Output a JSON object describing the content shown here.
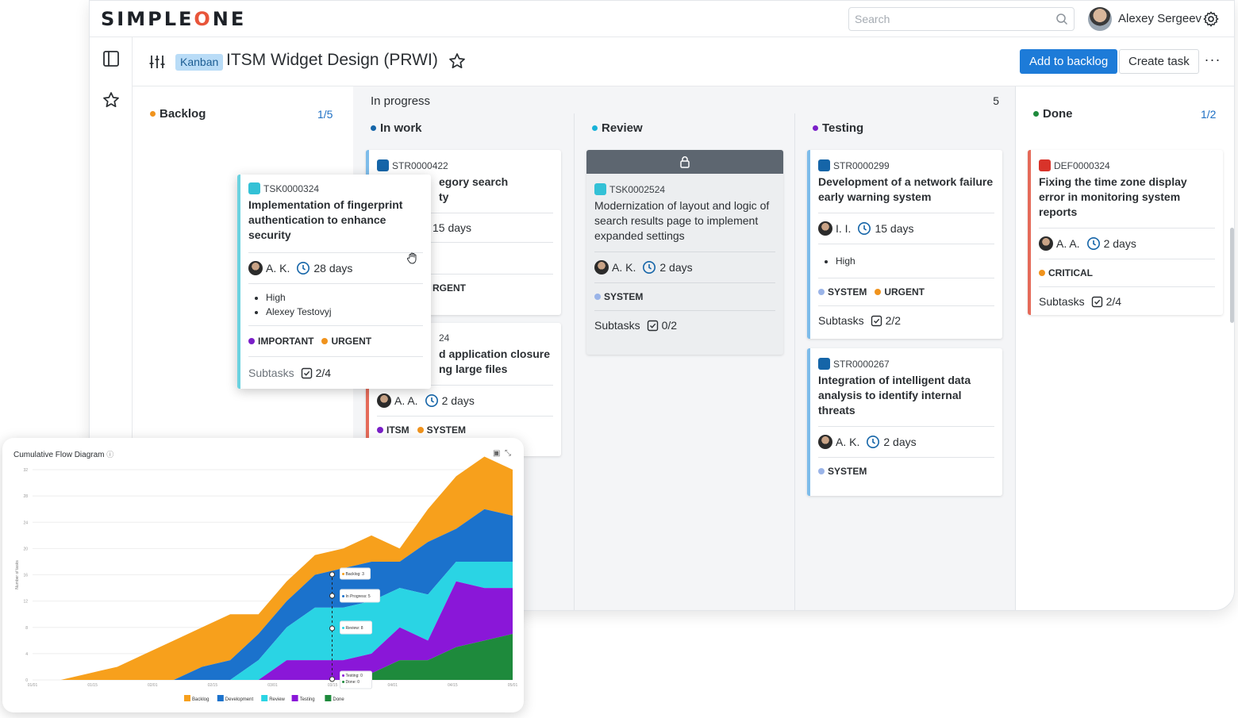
{
  "app": {
    "logo_left": "SIMPLE",
    "logo_o": "O",
    "logo_right": "NE",
    "search_placeholder": "Search",
    "user_name": "Alexey Sergeev"
  },
  "board": {
    "view_tag": "Kanban",
    "title": "ITSM Widget Design (PRWI)",
    "add_backlog": "Add to backlog",
    "create_task": "Create task",
    "more": "···"
  },
  "columns": {
    "backlog": {
      "label": "Backlog",
      "count": "1/5",
      "color": "#f0931d"
    },
    "in_progress": {
      "label": "In progress",
      "count": "5"
    },
    "in_work": {
      "label": "In work",
      "color": "#1565a8"
    },
    "review": {
      "label": "Review",
      "color": "#18b2d8"
    },
    "testing": {
      "label": "Testing",
      "color": "#7a1fc8"
    },
    "done": {
      "label": "Done",
      "count": "1/2",
      "color": "#1e8a3c"
    }
  },
  "cards": {
    "inwork1": {
      "code": "STR0000422",
      "title_visible": "egory search\nty",
      "days": "15 days",
      "tag": "RGENT"
    },
    "inwork2": {
      "code": "24",
      "title_visible": "d application closure\nng large files",
      "assignee": "A. A.",
      "days": "2 days",
      "tags": [
        "ITSM",
        "SYSTEM"
      ]
    },
    "review1": {
      "code": "TSK0002524",
      "title": "Modernization of layout and logic of search results page to implement expanded settings",
      "assignee": "A. K.",
      "days": "2 days",
      "tag": "SYSTEM",
      "subtasks_label": "Subtasks",
      "subtasks": "0/2"
    },
    "testing1": {
      "code": "STR0000299",
      "title": "Development of a network failure early warning system",
      "assignee": "I. I.",
      "days": "15 days",
      "priority": "High",
      "tags": [
        "SYSTEM",
        "URGENT"
      ],
      "subtasks_label": "Subtasks",
      "subtasks": "2/2"
    },
    "testing2": {
      "code": "STR0000267",
      "title": "Integration of intelligent data analysis to identify internal threats",
      "assignee": "A. K.",
      "days": "2 days",
      "tag": "SYSTEM"
    },
    "done1": {
      "code": "DEF0000324",
      "title": "Fixing the time zone display error in monitoring system reports",
      "assignee": "A. A.",
      "days": "2 days",
      "tag": "CRITICAL",
      "subtasks_label": "Subtasks",
      "subtasks": "2/4"
    },
    "dragged": {
      "code": "TSK0000324",
      "title": "Implementation of fingerprint authentication to enhance security",
      "assignee": "A. K.",
      "days": "28 days",
      "priority": "High",
      "person": "Alexey Testovyj",
      "tags": [
        "IMPORTANT",
        "URGENT"
      ],
      "subtasks_label": "Subtasks",
      "subtasks": "2/4"
    }
  },
  "colors": {
    "primary": "#1d7bd8",
    "system_tag": "#9ab4e8",
    "urgent_tag": "#f0931d",
    "important_tag": "#7a1fc8",
    "critical_tag": "#f0931d",
    "itsm_tag": "#7a1fc8"
  },
  "chart_data": {
    "type": "area",
    "title": "Cumulative Flow Diagram",
    "ylabel": "Number of tasks",
    "xlabel": "",
    "x": [
      "01/01",
      "01/15",
      "02/01",
      "02/15",
      "03/01",
      "03/15",
      "04/01",
      "04/15",
      "05/01"
    ],
    "yticks": [
      0,
      4,
      8,
      12,
      16,
      20,
      24,
      28,
      32
    ],
    "ylim": [
      0,
      32
    ],
    "stacked": true,
    "series": [
      {
        "name": "Done",
        "color": "#1e8a3c",
        "values": [
          0,
          0,
          0,
          0,
          0,
          0,
          0,
          0,
          0,
          0,
          0,
          0,
          1,
          3,
          3,
          5,
          6,
          7
        ]
      },
      {
        "name": "Testing",
        "color": "#8a17d8",
        "values": [
          0,
          0,
          0,
          0,
          0,
          0,
          0,
          0,
          0,
          3,
          3,
          3,
          3,
          5,
          3,
          10,
          8,
          7
        ]
      },
      {
        "name": "Review",
        "color": "#2ad4e4",
        "values": [
          0,
          0,
          0,
          0,
          0,
          0,
          0,
          0,
          3,
          5,
          8,
          8,
          8,
          6,
          7,
          3,
          4,
          4
        ]
      },
      {
        "name": "Development",
        "color": "#1b72cc",
        "values": [
          0,
          0,
          0,
          0,
          0,
          0,
          2,
          3,
          4,
          4,
          5,
          6,
          6,
          4,
          8,
          5,
          8,
          7
        ]
      },
      {
        "name": "Backlog",
        "color": "#f7a01c",
        "values": [
          0,
          0,
          1,
          2,
          4,
          6,
          6,
          7,
          3,
          3,
          3,
          3,
          4,
          2,
          5,
          8,
          8,
          7
        ]
      }
    ],
    "tooltip": [
      "Backlog: 3",
      "In Progress: 5",
      "Review: 8",
      "Testing: 0",
      "Done: 0"
    ],
    "legend": [
      "Backlog",
      "Development",
      "Review",
      "Testing",
      "Done"
    ],
    "legend_position": "bottom"
  }
}
